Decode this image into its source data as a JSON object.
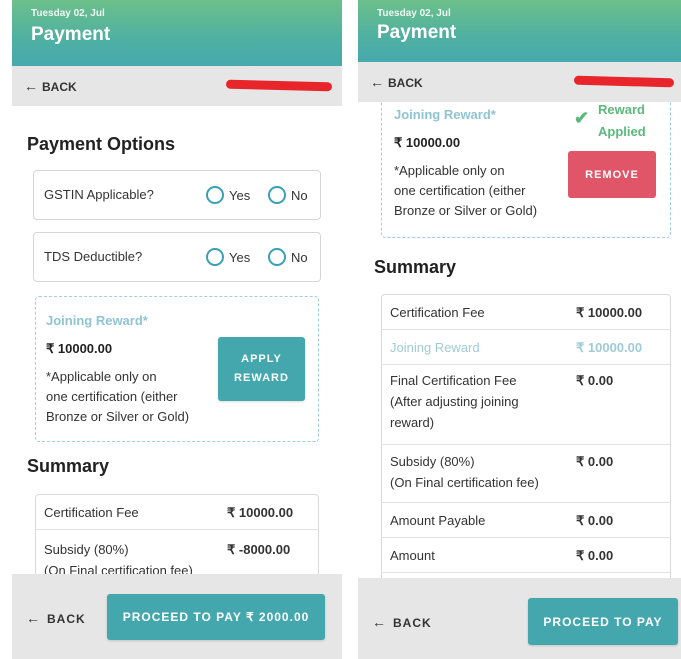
{
  "left": {
    "header": {
      "date": "Tuesday 02, Jul",
      "title": "Payment"
    },
    "nav": {
      "back": "BACK"
    },
    "payment_options": {
      "heading": "Payment Options",
      "gstin": {
        "label": "GSTIN Applicable?",
        "yes": "Yes",
        "no": "No"
      },
      "tds": {
        "label": "TDS Deductible?",
        "yes": "Yes",
        "no": "No"
      }
    },
    "reward": {
      "title": "Joining Reward*",
      "amount": "₹ 10000.00",
      "note_line1": "*Applicable only on",
      "note_line2": "one certification (either",
      "note_line3": "Bronze or Silver or Gold)",
      "button_line1": "APPLY",
      "button_line2": "REWARD"
    },
    "summary": {
      "heading": "Summary",
      "rows": [
        {
          "label": "Certification Fee",
          "value": "₹ 10000.00"
        },
        {
          "label_line1": "Subsidy (80%)",
          "label_line2": "(On Final certification fee)",
          "value": "₹ -8000.00"
        }
      ]
    },
    "footer": {
      "back": "BACK",
      "proceed": "PROCEED TO PAY ₹ 2000.00"
    }
  },
  "right": {
    "header": {
      "date": "Tuesday 02, Jul",
      "title": "Payment"
    },
    "nav": {
      "back": "BACK"
    },
    "reward": {
      "title": "Joining Reward*",
      "amount": "₹ 10000.00",
      "note_line1": "*Applicable only on",
      "note_line2": "one certification (either",
      "note_line3": "Bronze or Silver or Gold)",
      "applied_line1": "Reward",
      "applied_line2": "Applied",
      "remove": "REMOVE"
    },
    "summary": {
      "heading": "Summary",
      "rows": [
        {
          "label": "Certification Fee",
          "value": "₹ 10000.00"
        },
        {
          "label": "Joining Reward",
          "value": "₹ 10000.00"
        },
        {
          "label_line1": "Final Certification Fee",
          "label_line2": "(After adjusting joining",
          "label_line3": "reward)",
          "value": "₹ 0.00"
        },
        {
          "label_line1": "Subsidy (80%)",
          "label_line2": "(On Final certification fee)",
          "value": "₹ 0.00"
        },
        {
          "label": "Amount Payable",
          "value": "₹ 0.00"
        },
        {
          "label": "Amount",
          "value": "₹ 0.00"
        }
      ]
    },
    "footer": {
      "back": "BACK",
      "proceed": "PROCEED TO PAY"
    }
  },
  "colors": {
    "accent": "#43a7ad",
    "remove": "#e05567",
    "success": "#5bb97a",
    "reward_muted": "#8fc4d3",
    "redaction": "#e8252a"
  }
}
